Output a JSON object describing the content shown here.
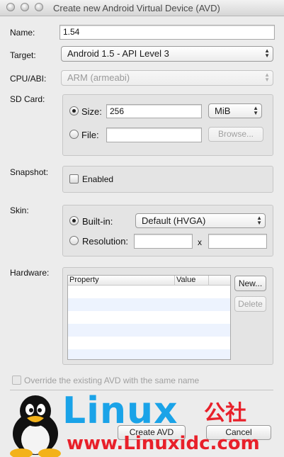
{
  "window": {
    "title": "Create new Android Virtual Device (AVD)"
  },
  "form": {
    "name_label": "Name:",
    "name_value": "1.54",
    "target_label": "Target:",
    "target_value": "Android 1.5 - API Level 3",
    "cpu_label": "CPU/ABI:",
    "cpu_value": "ARM (armeabi)",
    "sdcard_label": "SD Card:",
    "size_radio_label": "Size:",
    "size_value": "256",
    "size_unit": "MiB",
    "file_radio_label": "File:",
    "file_value": "",
    "browse_label": "Browse...",
    "snapshot_label": "Snapshot:",
    "snapshot_enabled_label": "Enabled",
    "skin_label": "Skin:",
    "builtin_radio_label": "Built-in:",
    "builtin_value": "Default (HVGA)",
    "resolution_radio_label": "Resolution:",
    "resolution_x_sep": "x",
    "hardware_label": "Hardware:",
    "hardware_columns": [
      "Property",
      "Value"
    ],
    "new_button": "New...",
    "delete_button": "Delete",
    "override_label": "Override the existing AVD with the same name"
  },
  "footer": {
    "create_button": "Create AVD",
    "cancel_button": "Cancel"
  },
  "watermark": {
    "logo_text": "Linux",
    "logo_cjk": "公社",
    "url": "www.Linuxidc.com"
  },
  "colors": {
    "watermark_blue": "#1aa3e8",
    "watermark_red": "#e8202a",
    "table_alt_row": "#edf3fe"
  }
}
